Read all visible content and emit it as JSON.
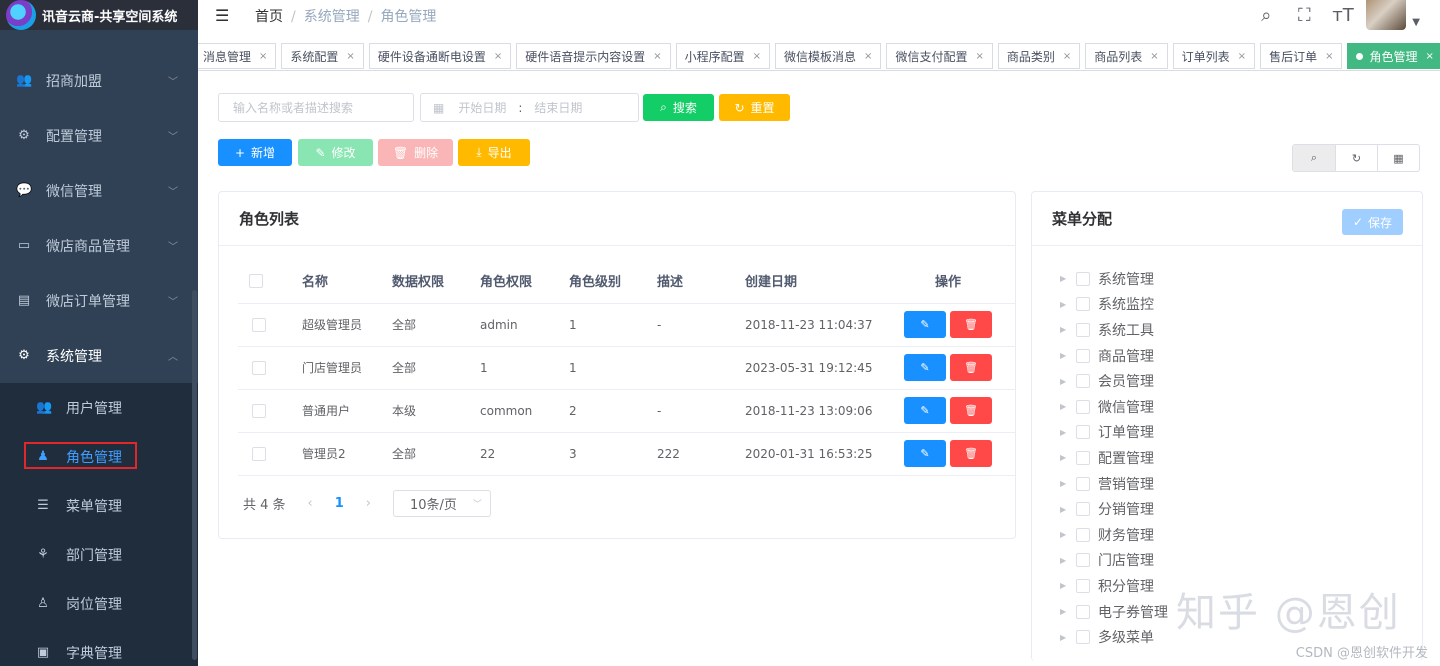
{
  "app": {
    "title": "讯音云商-共享空间系统"
  },
  "sidebar": {
    "items": [
      {
        "label": "招商加盟",
        "icon": "users-icon"
      },
      {
        "label": "配置管理",
        "icon": "gear-icon"
      },
      {
        "label": "微信管理",
        "icon": "wechat-icon"
      },
      {
        "label": "微店商品管理",
        "icon": "shop-icon"
      },
      {
        "label": "微店订单管理",
        "icon": "document-icon"
      },
      {
        "label": "系统管理",
        "icon": "gear-icon"
      }
    ],
    "submenu": [
      {
        "label": "用户管理",
        "icon": "user-icon"
      },
      {
        "label": "角色管理",
        "icon": "role-icon"
      },
      {
        "label": "菜单管理",
        "icon": "list-icon"
      },
      {
        "label": "部门管理",
        "icon": "tree-icon"
      },
      {
        "label": "岗位管理",
        "icon": "post-icon"
      },
      {
        "label": "字典管理",
        "icon": "dict-icon"
      }
    ]
  },
  "header": {
    "breadcrumb": [
      "首页",
      "系统管理",
      "角色管理"
    ],
    "separator": "/"
  },
  "tags": [
    "消息管理",
    "系统配置",
    "硬件设备通断电设置",
    "硬件语音提示内容设置",
    "小程序配置",
    "微信模板消息",
    "微信支付配置",
    "商品类别",
    "商品列表",
    "订单列表",
    "售后订单",
    "角色管理"
  ],
  "search": {
    "keyword_placeholder": "输入名称或者描述搜索",
    "start_placeholder": "开始日期",
    "range_sep": ":",
    "end_placeholder": "结束日期",
    "search_label": "搜索",
    "reset_label": "重置"
  },
  "actions": {
    "add": "新增",
    "edit": "修改",
    "delete": "删除",
    "export": "导出"
  },
  "role_list": {
    "title": "角色列表",
    "columns": [
      "名称",
      "数据权限",
      "角色权限",
      "角色级别",
      "描述",
      "创建日期",
      "操作"
    ],
    "rows": [
      {
        "name": "超级管理员",
        "data_scope": "全部",
        "permission": "admin",
        "level": "1",
        "desc": "-",
        "created": "2018-11-23 11:04:37"
      },
      {
        "name": "门店管理员",
        "data_scope": "全部",
        "permission": "1",
        "level": "1",
        "desc": "",
        "created": "2023-05-31 19:12:45"
      },
      {
        "name": "普通用户",
        "data_scope": "本级",
        "permission": "common",
        "level": "2",
        "desc": "-",
        "created": "2018-11-23 13:09:06"
      },
      {
        "name": "管理员2",
        "data_scope": "全部",
        "permission": "22",
        "level": "3",
        "desc": "222",
        "created": "2020-01-31 16:53:25"
      }
    ],
    "pagination": {
      "total": "共 4 条",
      "prev": "‹",
      "page": "1",
      "next": "›",
      "page_size": "10条/页"
    }
  },
  "menu_assign": {
    "title": "菜单分配",
    "save_label": "保存",
    "nodes": [
      "系统管理",
      "系统监控",
      "系统工具",
      "商品管理",
      "会员管理",
      "微信管理",
      "订单管理",
      "配置管理",
      "营销管理",
      "分销管理",
      "财务管理",
      "门店管理",
      "积分管理",
      "电子券管理",
      "多级菜单"
    ]
  },
  "watermark": {
    "text": "知乎 @恩创",
    "csdn": "CSDN @恩创软件开发"
  },
  "colors": {
    "sidebar": "#304156",
    "primary": "#1890ff",
    "success": "#13ce66",
    "warning": "#ffba00",
    "danger": "#ff4949",
    "active_tag": "#42b983"
  }
}
